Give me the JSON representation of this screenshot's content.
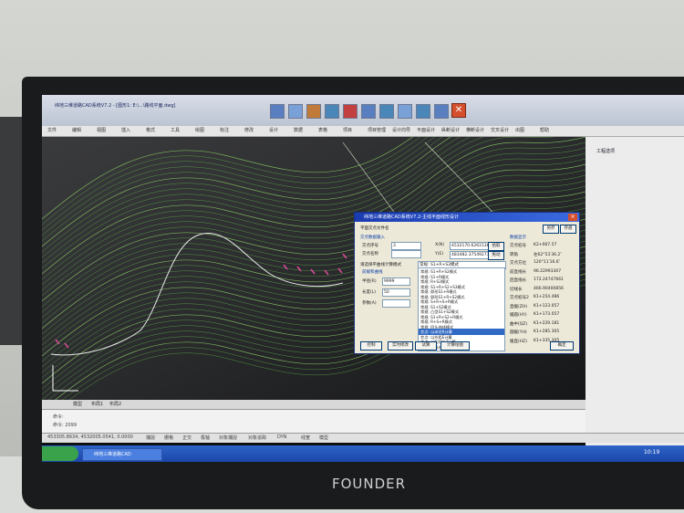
{
  "app": {
    "title": "纬地三维道路CAD系统V7.2 - [图形1: E:\\...\\路线平面.dwg]",
    "tool_icons": [
      "line-tool-icon",
      "curve-tool-icon",
      "profile-tool-icon",
      "cross-section-icon",
      "table-icon",
      "layer-icon",
      "view-icon",
      "report-icon",
      "setup-icon",
      "help-icon"
    ],
    "close_glyph": "✕"
  },
  "menu": {
    "items": [
      "文件",
      "编辑",
      "视图",
      "插入",
      "格式",
      "工具",
      "绘图",
      "标注",
      "修改",
      "设计",
      "数据",
      "表格",
      "项目",
      "项目管理",
      "设计向导",
      "平面设计",
      "纵断设计",
      "横断设计",
      "交叉设计",
      "出图",
      "帮助"
    ]
  },
  "dialog": {
    "title": "纬地三维道路CAD系统V7.2-主线平面线形设计",
    "file_label": "平面交点文件名",
    "save_label": "存盘",
    "save_as_label": "另存",
    "point_section": "交点数据输入",
    "point_no_label": "交点序号",
    "point_no_value": "3",
    "point_name_label": "交点名称",
    "x_label": "X(N)",
    "x_value": "4532170.6261536",
    "y_label": "Y(E)",
    "y_value": "483482.37549273",
    "pick_label": "拾取",
    "drag_label": "拖动",
    "radius_label": "半径(R)",
    "radius_value": "9999",
    "length_label": "长度(L)",
    "length_value": "50",
    "param_label": "参数(A)",
    "mode_label": "请选择平曲线计算模式",
    "mode_value": "常规: S1+R+S2模式",
    "mode_section": "前缓和曲线",
    "mode_options": [
      "常规: S1+R+S2模式",
      "常规: S1+R模式",
      "常规: R+S2模式",
      "常规: S1+R+S2+S3模式",
      "常规: 卵形S1+R模式",
      "常规: 卵形S1+R+S2模式",
      "常规: S+R+S+R模式",
      "常规: S1+S2模式",
      "常规: 凸型S1+S2模式",
      "常规: S1+R+S2+R模式",
      "常规: R+S+R模式",
      "常规: 回头曲线模式",
      "交点: 以半径R计算",
      "交点: 以外距E计算",
      "交点: 以切线长T计算",
      "交点: 曲线长计算"
    ],
    "selected_index": 12,
    "data_section": "数据显示",
    "data": [
      {
        "label": "交点桩号",
        "value": "K2+067.57"
      },
      {
        "label": "转角",
        "value": "左62°53′36.2″"
      },
      {
        "label": "交点方位",
        "value": "120°11′16.6″"
      },
      {
        "label": "前直线长",
        "value": "96.22993307"
      },
      {
        "label": "后直线长",
        "value": "172.24747661"
      },
      {
        "label": "切线长",
        "value": "466.90400856"
      },
      {
        "label": "交点桩号2",
        "value": "K1+254.486"
      },
      {
        "label": "直缓(ZH)",
        "value": "K1+123.057"
      },
      {
        "label": "缓圆(HY)",
        "value": "K1+173.057"
      },
      {
        "label": "曲中(QZ)",
        "value": "K1+229.181"
      },
      {
        "label": "圆缓(YH)",
        "value": "K1+285.305"
      },
      {
        "label": "缓直(HZ)",
        "value": "K1+335.305"
      }
    ],
    "buttons": [
      "控制",
      "实时修改",
      "试算",
      "计算绘图",
      "确定"
    ]
  },
  "side_panel": {
    "title": "工程选项"
  },
  "tabs": [
    "模型",
    "布局1",
    "布局2"
  ],
  "command": {
    "line1": "命令:",
    "line2": "命令: 2099"
  },
  "status": [
    "453305.8634, 4532005.0541, 0.0000",
    "捕捉",
    "栅格",
    "正交",
    "极轴",
    "对象捕捉",
    "对象追踪",
    "DYN",
    "线宽",
    "模型"
  ],
  "taskbar": {
    "start": "开始",
    "app": "纬地三维道路CAD",
    "clock": "10:19"
  },
  "colors": {
    "contour_green": "#5fb04a",
    "contour_pink": "#d84a98",
    "road_white": "#e8e8e8",
    "accent_blue": "#2e63c9"
  }
}
